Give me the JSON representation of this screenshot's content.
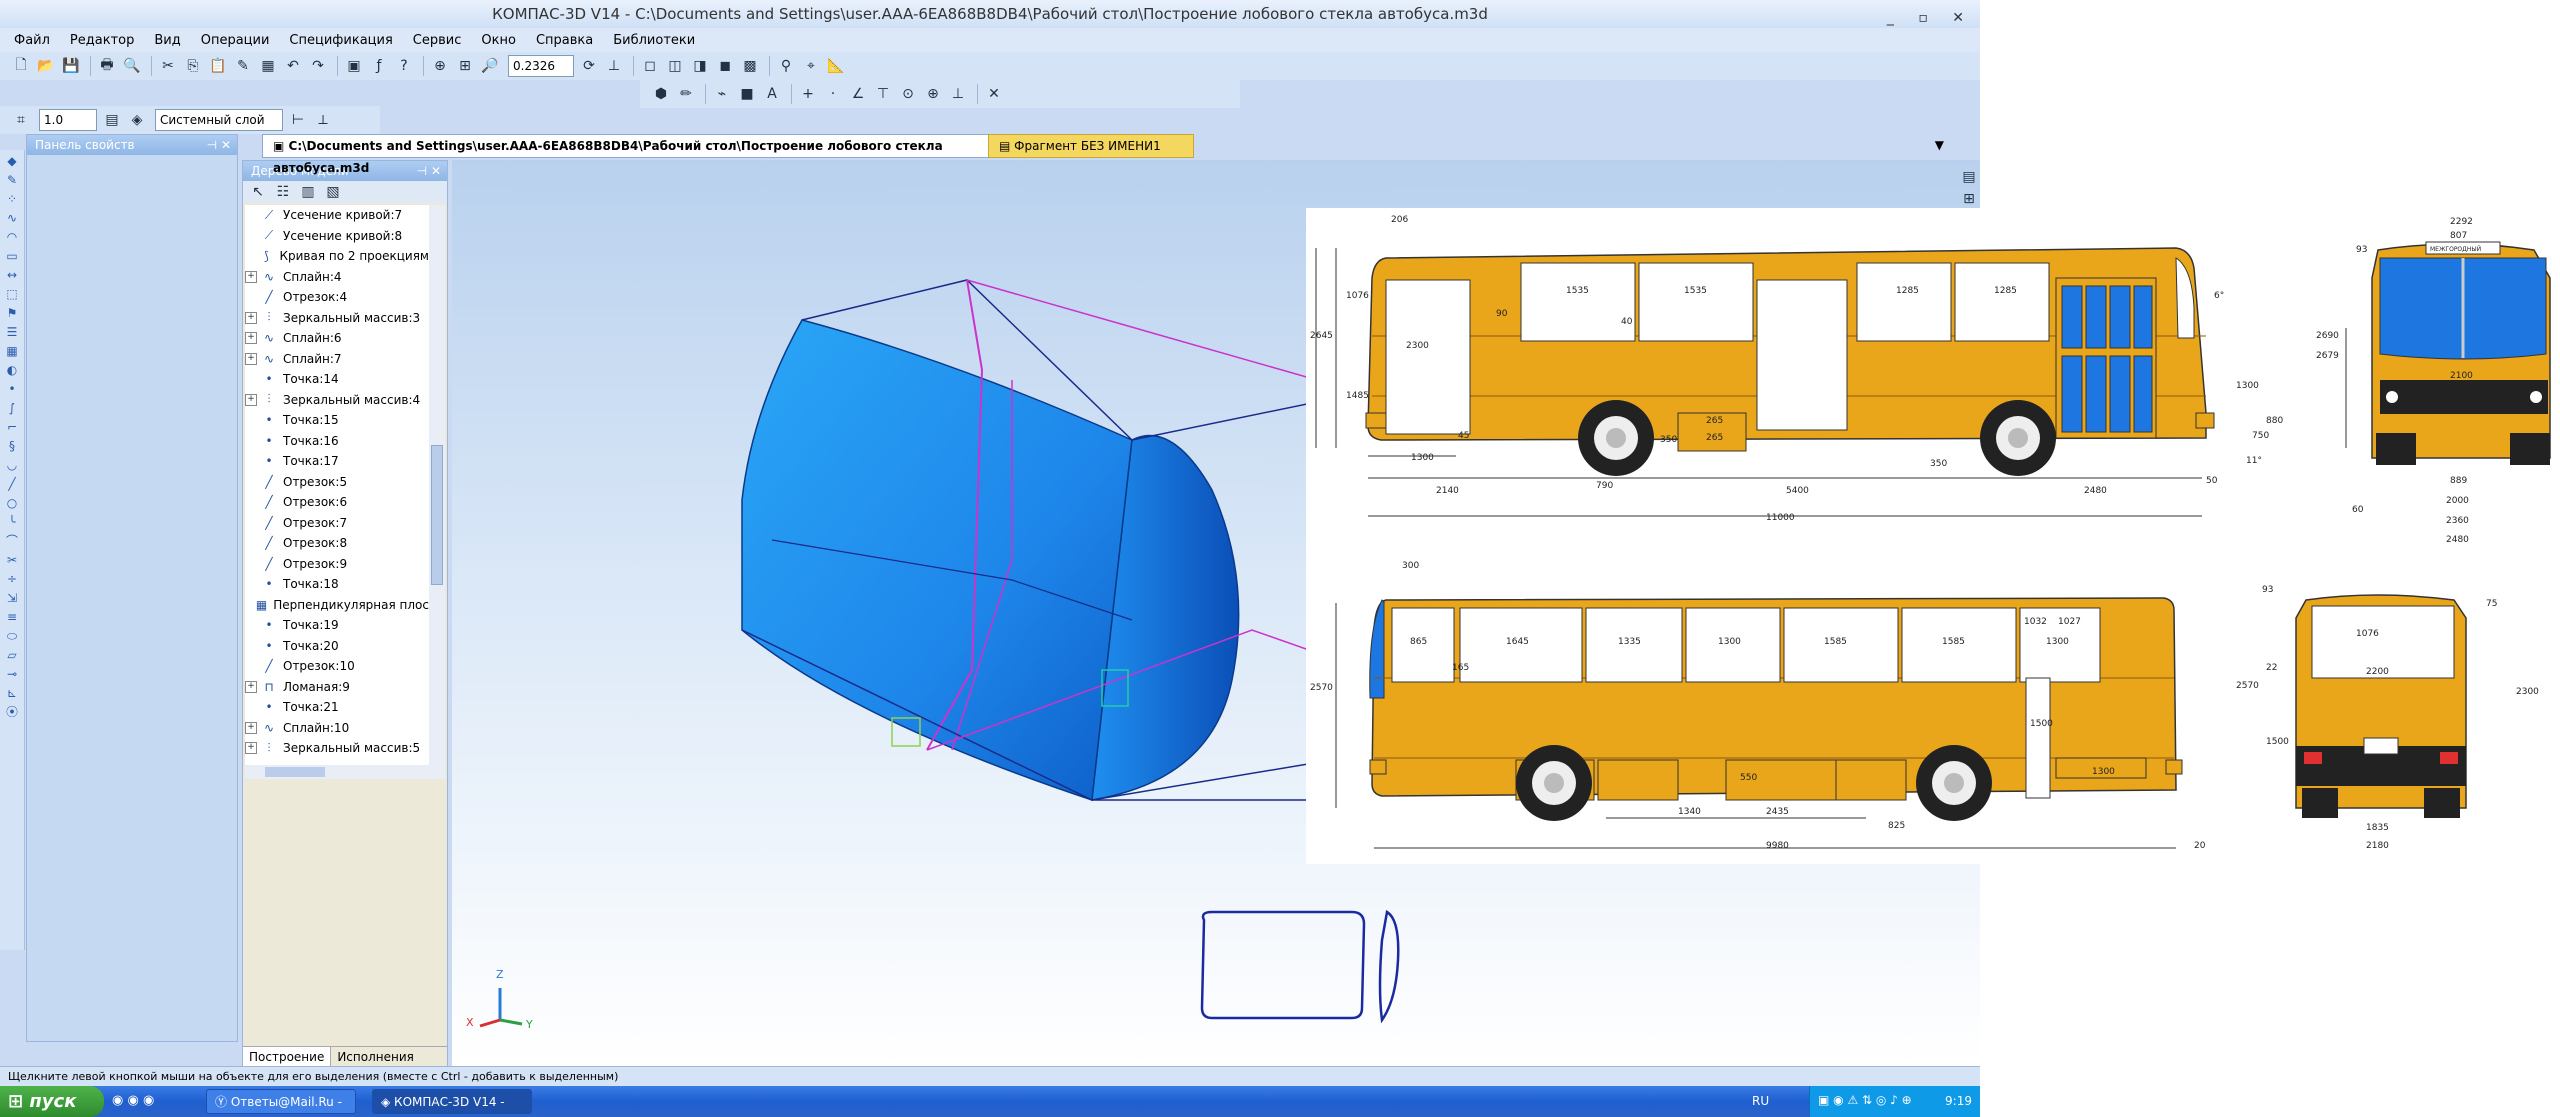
{
  "window": {
    "title": "КОМПАС-3D V14 - C:\\Documents and Settings\\user.AAA-6EA868B8DB4\\Рабочий стол\\Построение лобового стекла автобуса.m3d",
    "controls": [
      "_",
      "▫",
      "✕"
    ]
  },
  "menu": [
    "Файл",
    "Редактор",
    "Вид",
    "Операции",
    "Спецификация",
    "Сервис",
    "Окно",
    "Справка",
    "Библиотеки"
  ],
  "toolbar": {
    "zoom_value": "0.2326",
    "scale_value": "1.0",
    "layer_value": "Системный слой (0)"
  },
  "panels": {
    "properties_title": "Панель свойств",
    "tree_title": "Дерево модели",
    "tree_tabs": [
      "Построение",
      "Исполнения"
    ]
  },
  "tree_items": [
    {
      "label": "Усечение кривой:7",
      "icon": "trim-icon",
      "expand": false
    },
    {
      "label": "Усечение кривой:8",
      "icon": "trim-icon",
      "expand": false
    },
    {
      "label": "Кривая по 2 проекциям",
      "icon": "curve-icon",
      "expand": false
    },
    {
      "label": "Сплайн:4",
      "icon": "spline-icon",
      "expand": true
    },
    {
      "label": "Отрезок:4",
      "icon": "segment-icon",
      "expand": false
    },
    {
      "label": "Зеркальный массив:3",
      "icon": "mirror-icon",
      "expand": true
    },
    {
      "label": "Сплайн:6",
      "icon": "spline-icon",
      "expand": true
    },
    {
      "label": "Сплайн:7",
      "icon": "spline-icon",
      "expand": true
    },
    {
      "label": "Точка:14",
      "icon": "point-icon",
      "expand": false
    },
    {
      "label": "Зеркальный массив:4",
      "icon": "mirror-icon",
      "expand": true
    },
    {
      "label": "Точка:15",
      "icon": "point-icon",
      "expand": false
    },
    {
      "label": "Точка:16",
      "icon": "point-icon",
      "expand": false
    },
    {
      "label": "Точка:17",
      "icon": "point-icon",
      "expand": false
    },
    {
      "label": "Отрезок:5",
      "icon": "segment-icon",
      "expand": false
    },
    {
      "label": "Отрезок:6",
      "icon": "segment-icon",
      "expand": false
    },
    {
      "label": "Отрезок:7",
      "icon": "segment-icon",
      "expand": false
    },
    {
      "label": "Отрезок:8",
      "icon": "segment-icon",
      "expand": false
    },
    {
      "label": "Отрезок:9",
      "icon": "segment-icon",
      "expand": false
    },
    {
      "label": "Точка:18",
      "icon": "point-icon",
      "expand": false
    },
    {
      "label": "Перпендикулярная плос",
      "icon": "plane-icon",
      "expand": false
    },
    {
      "label": "Точка:19",
      "icon": "point-icon",
      "expand": false
    },
    {
      "label": "Точка:20",
      "icon": "point-icon",
      "expand": false
    },
    {
      "label": "Отрезок:10",
      "icon": "segment-icon",
      "expand": false
    },
    {
      "label": "Ломаная:9",
      "icon": "polyline-icon",
      "expand": true
    },
    {
      "label": "Точка:21",
      "icon": "point-icon",
      "expand": false
    },
    {
      "label": "Сплайн:10",
      "icon": "spline-icon",
      "expand": true
    },
    {
      "label": "Зеркальный массив:5",
      "icon": "mirror-icon",
      "expand": true
    }
  ],
  "doc_tabs": [
    {
      "label": "C:\\Documents and Settings\\user.AAA-6EA868B8DB4\\Рабочий стол\\Построение лобового стекла автобуса.m3d",
      "active": true
    },
    {
      "label": "Фрагмент БЕЗ ИМЕНИ1",
      "active": false
    }
  ],
  "axes": {
    "x": "X",
    "y": "Y",
    "z": "Z"
  },
  "status": "Щелкните левой кнопкой мыши на объекте для его выделения (вместе с Ctrl - добавить к выделенным)",
  "taskbar": {
    "start": "пуск",
    "tasks": [
      "Ответы@Mail.Ru - Y...",
      "КОМПАС-3D V14 - C:..."
    ],
    "lang": "RU",
    "time": "9:19"
  },
  "drawing": {
    "top_view": {
      "dims": [
        "206",
        "1076",
        "2645",
        "1485",
        "2300",
        "90",
        "1535",
        "1535",
        "40",
        "1285",
        "1285",
        "6°",
        "2690",
        "2679",
        "1300",
        "880",
        "750",
        "45",
        "265",
        "265",
        "350",
        "1300",
        "2140",
        "790",
        "5400",
        "350",
        "2480",
        "50",
        "11°",
        "11000"
      ]
    },
    "front_view": {
      "sign": "МЕЖГОРОДНЫЙ",
      "dims": [
        "2292",
        "807",
        "93",
        "2100",
        "889",
        "2000",
        "2360",
        "2480",
        "60"
      ]
    },
    "bottom_view": {
      "dims": [
        "300",
        "2570",
        "865",
        "1645",
        "1335",
        "1300",
        "1585",
        "1585",
        "1032",
        "1027",
        "165",
        "1300",
        "1500",
        "550",
        "1300",
        "1340",
        "2435",
        "825",
        "9980",
        "20"
      ]
    },
    "rear_view": {
      "dims": [
        "93",
        "75",
        "1076",
        "2570",
        "22",
        "2200",
        "2300",
        "1500",
        "1835",
        "2180"
      ]
    },
    "colors": {
      "body": "#e9a61a",
      "glass": "#1e77e0",
      "outline": "#333333"
    }
  }
}
